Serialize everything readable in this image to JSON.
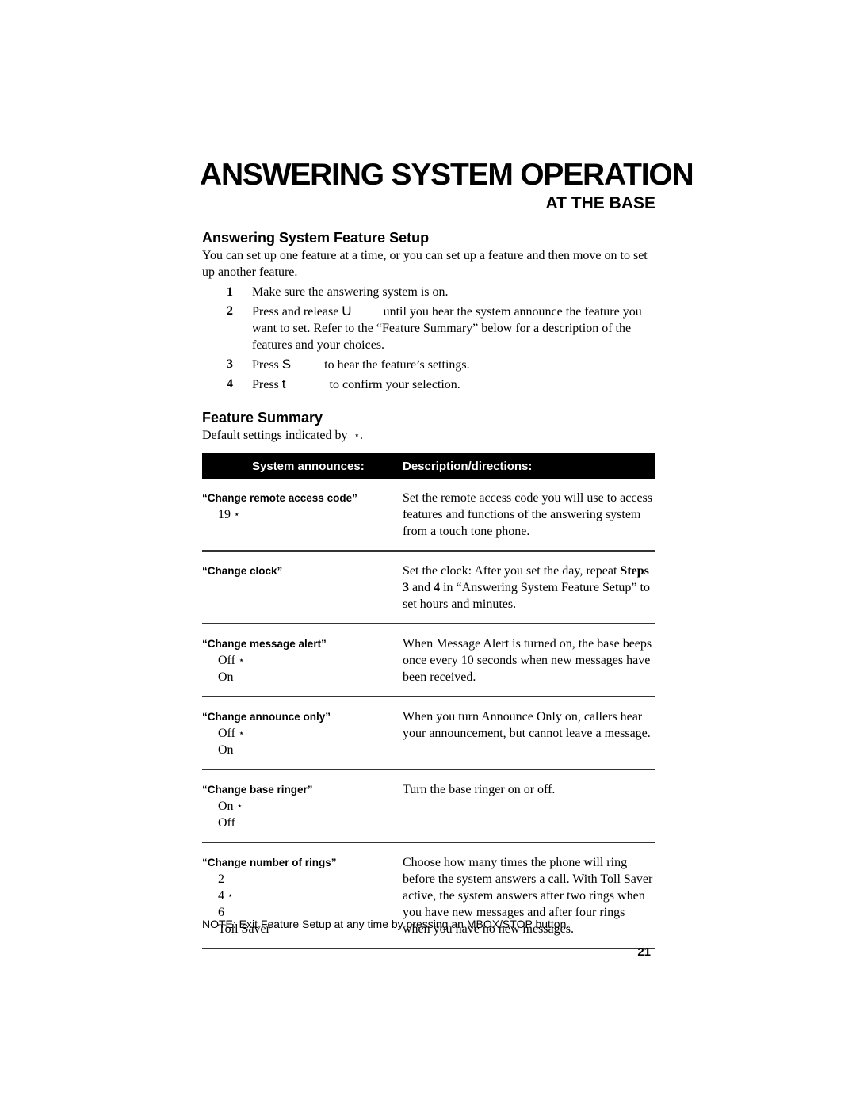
{
  "header": {
    "title": "ANSWERING SYSTEM OPERATION",
    "subtitle": "AT THE BASE"
  },
  "setup": {
    "heading": "Answering System Feature Setup",
    "intro": "You can set up one feature at a time, or you can set up a feature and then move on to set up another feature.",
    "steps": [
      {
        "num": "1",
        "text": "Make sure the answering system is on."
      },
      {
        "num": "2",
        "pre": "Press and release ",
        "key": "U",
        "post": "until you hear the system announce the feature you want to set.  Refer to the “Feature Summary” below for a description of the features and your choices."
      },
      {
        "num": "3",
        "pre": "Press ",
        "key": "S",
        "post": "to hear the feature’s settings."
      },
      {
        "num": "4",
        "pre": "Press ",
        "key": "t",
        "post": "to confirm your selection."
      }
    ]
  },
  "summary": {
    "heading": "Feature Summary",
    "default_note_pre": "Default settings indicated by ",
    "default_marker": "⋆",
    "default_note_post": ".",
    "table": {
      "col_announces": "System announces:",
      "col_description": "Description/directions:",
      "rows": [
        {
          "announce": "“Change remote access code”",
          "options": [
            {
              "label": "19",
              "default": true
            }
          ],
          "description": "Set the remote access code you will use to access features and functions of the answering system from a touch tone phone."
        },
        {
          "announce": "“Change clock”",
          "options": [],
          "description_parts": {
            "a": "Set the clock: After you set the day, repeat ",
            "b": "Steps 3",
            "c": " and ",
            "d": "4",
            "e": " in “Answering System Feature Setup” to set hours and minutes."
          }
        },
        {
          "announce": "“Change message alert”",
          "options": [
            {
              "label": "Off",
              "default": true
            },
            {
              "label": "On",
              "default": false
            }
          ],
          "description": "When Message Alert is turned on, the base beeps once every 10 seconds when new messages have been received."
        },
        {
          "announce": "“Change announce only”",
          "options": [
            {
              "label": "Off",
              "default": true
            },
            {
              "label": "On",
              "default": false
            }
          ],
          "description": "When you turn Announce Only on, callers hear your announcement, but cannot leave a message."
        },
        {
          "announce": "“Change base ringer”",
          "options": [
            {
              "label": "On",
              "default": true
            },
            {
              "label": "Off",
              "default": false
            }
          ],
          "description": "Turn the base ringer on or off."
        },
        {
          "announce": "“Change number of rings”",
          "options": [
            {
              "label": "2",
              "default": false
            },
            {
              "label": "4",
              "default": true
            },
            {
              "label": "6",
              "default": false
            },
            {
              "label": "Toll Saver",
              "default": false
            }
          ],
          "description": "Choose how many times the phone will ring before the system answers a call. With Toll Saver active, the system answers after two rings when you have new messages and after four rings when you have no new messages."
        }
      ]
    }
  },
  "note": "NOTE:  Exit Feature Setup at any time by pressing an MBOX/STOP button.",
  "page_number": "21"
}
